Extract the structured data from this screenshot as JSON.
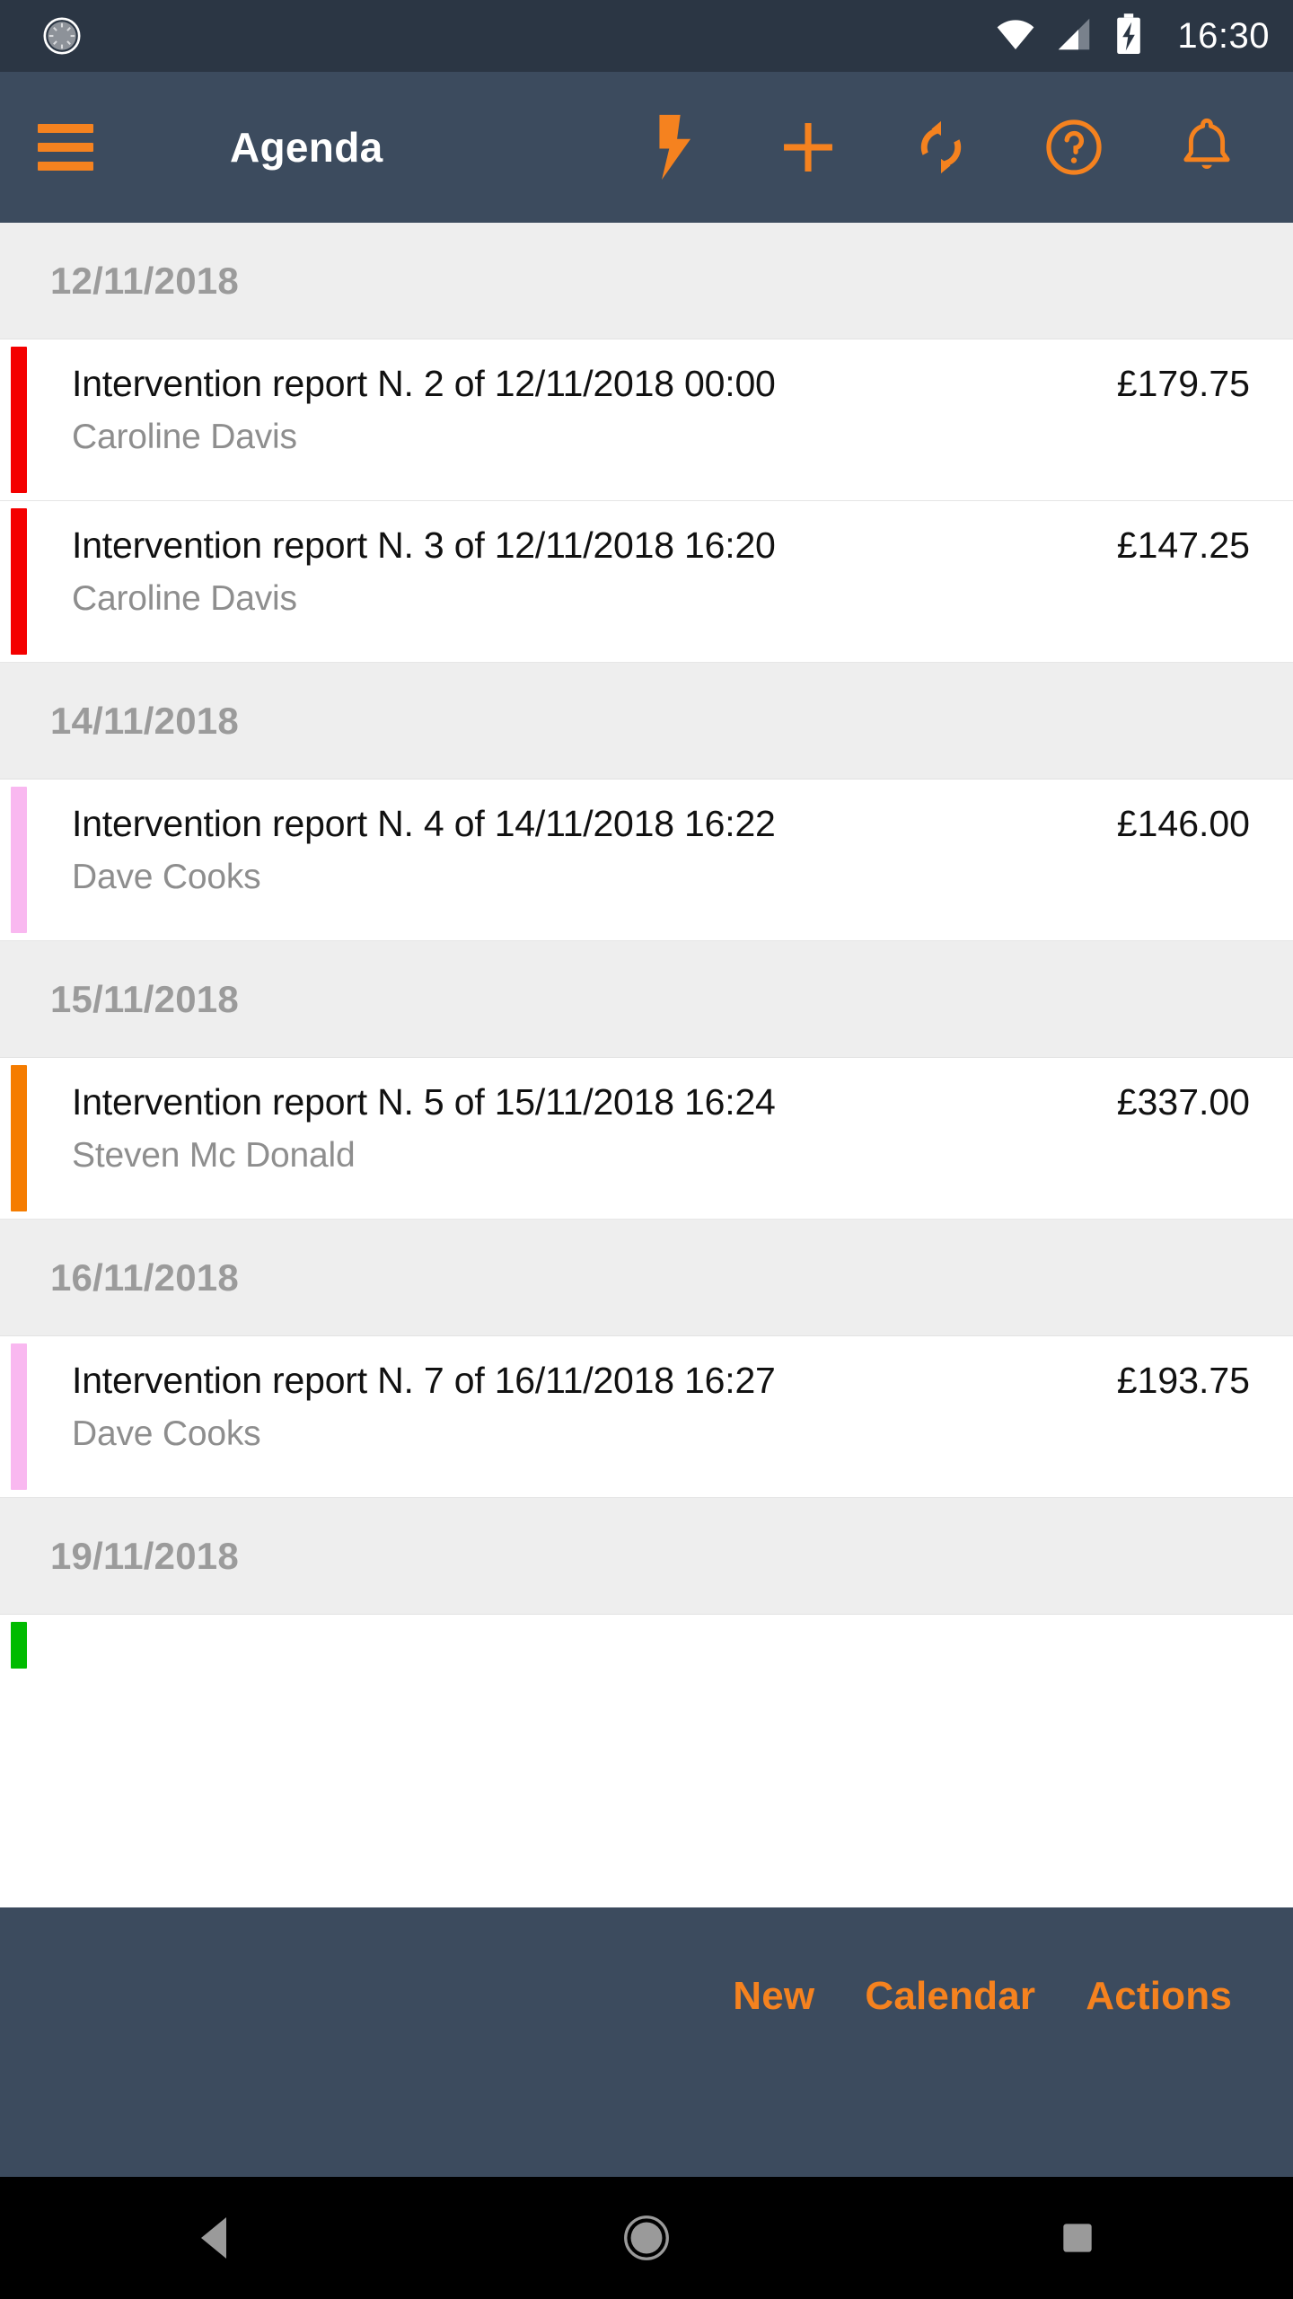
{
  "status_bar": {
    "left_icon": "spinner-icon",
    "wifi_icon": "wifi-icon",
    "signal_icon": "cellular-signal-icon",
    "battery_icon": "battery-charging-icon",
    "clock": "16:30",
    "background_color": "#2b3644",
    "text_color": "#ffffff"
  },
  "app_bar": {
    "menu_icon": "hamburger-menu-icon",
    "title": "Agenda",
    "background_color": "#3c4b5e",
    "accent_color": "#f5821f",
    "actions": [
      {
        "name": "flash-icon",
        "label": "Flash"
      },
      {
        "name": "plus-icon",
        "label": "Add"
      },
      {
        "name": "sync-icon",
        "label": "Sync"
      },
      {
        "name": "help-icon",
        "label": "Help"
      },
      {
        "name": "bell-icon",
        "label": "Notifications"
      }
    ]
  },
  "agenda": {
    "groups": [
      {
        "date": "12/11/2018",
        "items": [
          {
            "title": "Intervention report N. 2 of 12/11/2018 00:00",
            "subtitle": "Caroline Davis",
            "amount": "£179.75",
            "stripe_color": "#f40000"
          },
          {
            "title": "Intervention report N. 3 of 12/11/2018 16:20",
            "subtitle": "Caroline Davis",
            "amount": "£147.25",
            "stripe_color": "#f40000"
          }
        ]
      },
      {
        "date": "14/11/2018",
        "items": [
          {
            "title": "Intervention report N. 4 of 14/11/2018 16:22",
            "subtitle": "Dave Cooks",
            "amount": "£146.00",
            "stripe_color": "#f9b8f0"
          }
        ]
      },
      {
        "date": "15/11/2018",
        "items": [
          {
            "title": "Intervention report N. 5 of 15/11/2018 16:24",
            "subtitle": "Steven Mc Donald",
            "amount": "£337.00",
            "stripe_color": "#f57c00"
          }
        ]
      },
      {
        "date": "16/11/2018",
        "items": [
          {
            "title": "Intervention report N. 7 of 16/11/2018 16:27",
            "subtitle": "Dave Cooks",
            "amount": "£193.75",
            "stripe_color": "#f9b8f0"
          }
        ]
      },
      {
        "date": "19/11/2018",
        "items": [
          {
            "title": "",
            "subtitle": "",
            "amount": "",
            "stripe_color": "#00bb00"
          }
        ]
      }
    ],
    "header_background": "#eeeeee",
    "header_text_color": "#9b9b9b",
    "row_background": "#ffffff"
  },
  "footer_bar": {
    "background_color": "#3c4b5e",
    "text_color": "#f5821f",
    "buttons": [
      {
        "name": "new-button",
        "label": "New"
      },
      {
        "name": "calendar-button",
        "label": "Calendar"
      },
      {
        "name": "actions-button",
        "label": "Actions"
      }
    ]
  },
  "nav_bar": {
    "background_color": "#000000",
    "back": "back-triangle-icon",
    "home": "home-circle-icon",
    "recents": "recents-square-icon"
  }
}
